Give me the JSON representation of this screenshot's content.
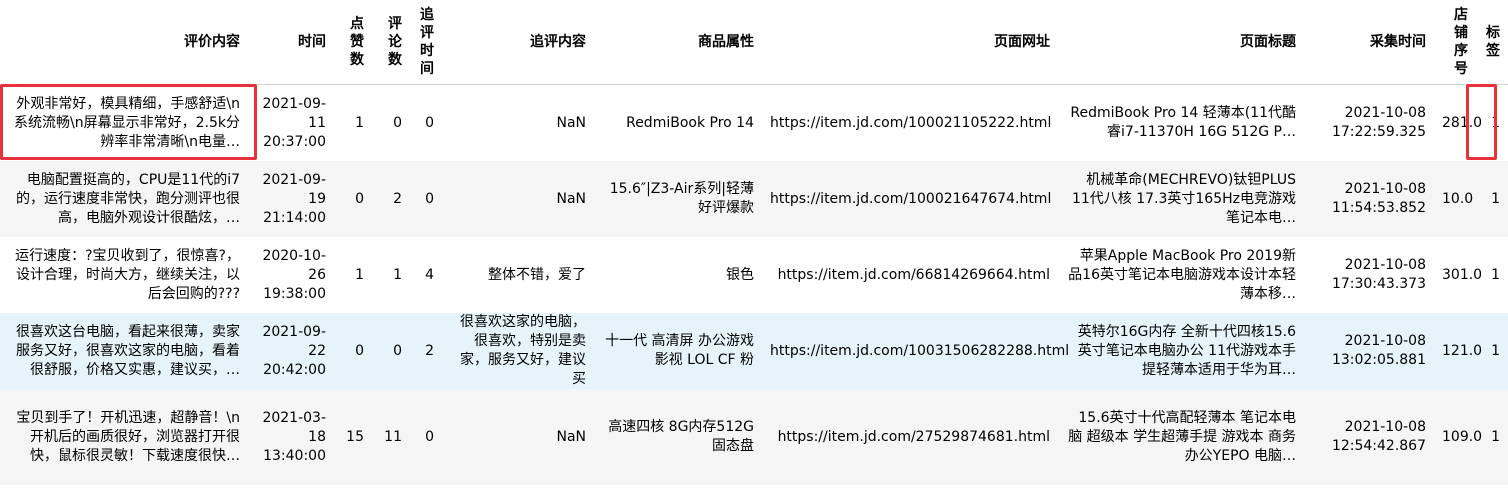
{
  "columns": [
    "评价内容",
    "时间",
    "点赞数",
    "评论数",
    "追评时间",
    "追评内容",
    "商品属性",
    "页面网址",
    "页面标题",
    "采集时间",
    "店铺序号",
    "标签"
  ],
  "rows": [
    {
      "review": "外观非常好，模具精细，手感舒适\\n系统流畅\\n屏幕显示非常好，2.5k分辨率非常清晰\\n电量…",
      "time": "2021-09-11 20:37:00",
      "likes": "1",
      "comments": "0",
      "follow_time": "0",
      "follow_content": "NaN",
      "attr": "RedmiBook Pro 14",
      "url": "https://item.jd.com/100021105222.html",
      "title": "RedmiBook Pro 14 轻薄本(11代酷睿i7-11370H 16G 512G P…",
      "collect_time": "2021-10-08 17:22:59.325",
      "shop": "281.0",
      "label": "1"
    },
    {
      "review": "电脑配置挺高的，CPU是11代的i7的，运行速度非常快，跑分测评也很高，电脑外观设计很酷炫，…",
      "time": "2021-09-19 21:14:00",
      "likes": "0",
      "comments": "2",
      "follow_time": "0",
      "follow_content": "NaN",
      "attr": "15.6″|Z3-Air系列|轻薄好评爆款",
      "url": "https://item.jd.com/100021647674.html",
      "title": "机械革命(MECHREVO)钛钽PLUS 11代八核 17.3英寸165Hz电竞游戏笔记本电…",
      "collect_time": "2021-10-08 11:54:53.852",
      "shop": "10.0",
      "label": "1"
    },
    {
      "review": "运行速度：?宝贝收到了，很惊喜?，设计合理，时尚大方，继续关注，以后会回购的???",
      "time": "2020-10-26 19:38:00",
      "likes": "1",
      "comments": "1",
      "follow_time": "4",
      "follow_content": "整体不错，爱了",
      "attr": "银色",
      "url": "https://item.jd.com/66814269664.html",
      "title": "苹果Apple MacBook Pro 2019新品16英寸笔记本电脑游戏本设计本轻薄本移…",
      "collect_time": "2021-10-08 17:30:43.373",
      "shop": "301.0",
      "label": "1"
    },
    {
      "review": "很喜欢这台电脑，看起来很薄，卖家服务又好，很喜欢这家的电脑，看着很舒服，价格又实惠，建议买，…",
      "time": "2021-09-22 20:42:00",
      "likes": "0",
      "comments": "0",
      "follow_time": "2",
      "follow_content": "很喜欢这家的电脑，很喜欢，特别是卖家，服务又好，建议买",
      "attr": "十一代 高清屏 办公游戏 影视 LOL CF 粉",
      "url": "https://item.jd.com/10031506282288.html",
      "title": "英特尔16G内存 全新十代四核15.6英寸笔记本电脑办公 11代游戏本手提轻薄本适用于华为耳…",
      "collect_time": "2021-10-08 13:02:05.881",
      "shop": "121.0",
      "label": "1"
    },
    {
      "review": "宝贝到手了！开机迅速，超静音！\\n开机后的画质很好，浏览器打开很快，鼠标很灵敏！下载速度很快…",
      "time": "2021-03-18 13:40:00",
      "likes": "15",
      "comments": "11",
      "follow_time": "0",
      "follow_content": "NaN",
      "attr": "高速四核 8G内存512G固态盘",
      "url": "https://item.jd.com/27529874681.html",
      "title": "15.6英寸十代高配轻薄本 笔记本电脑 超级本 学生超薄手提 游戏本 商务办公YEPO 电脑…",
      "collect_time": "2021-10-08 12:54:42.867",
      "shop": "109.0",
      "label": "1"
    }
  ]
}
